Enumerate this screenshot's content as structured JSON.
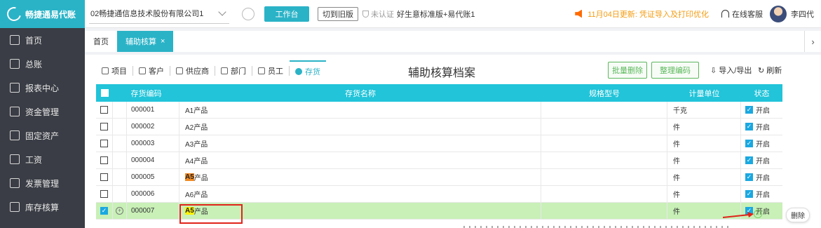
{
  "app": {
    "name": "畅捷通易代账"
  },
  "sidebar": {
    "items": [
      {
        "label": "首页",
        "icon": "home-icon"
      },
      {
        "label": "总账",
        "icon": "ledger-icon"
      },
      {
        "label": "报表中心",
        "icon": "chart-icon"
      },
      {
        "label": "资金管理",
        "icon": "money-icon"
      },
      {
        "label": "固定资产",
        "icon": "building-icon"
      },
      {
        "label": "工资",
        "icon": "wage-icon"
      },
      {
        "label": "发票管理",
        "icon": "invoice-icon"
      },
      {
        "label": "库存核算",
        "icon": "warehouse-icon"
      }
    ]
  },
  "topbar": {
    "company": "02畅捷通信息技术股份有限公司1",
    "workbench": "工作台",
    "old_version": "切到旧版",
    "auth_status": "未认证",
    "edition": "好生意标准版+易代账1",
    "notice": "11月04日更新: 凭证导入及打印优化",
    "service": "在线客服",
    "user": "李四代"
  },
  "tabs": {
    "home": "首页",
    "aux": "辅助核算",
    "close": "×"
  },
  "subnav": {
    "items": [
      {
        "label": "项目",
        "icon": "list-icon"
      },
      {
        "label": "客户",
        "icon": "user-icon"
      },
      {
        "label": "供应商",
        "icon": "supplier-icon"
      },
      {
        "label": "部门",
        "icon": "department-icon"
      },
      {
        "label": "员工",
        "icon": "employee-icon"
      },
      {
        "label": "存货",
        "icon": "inventory-icon",
        "active": true
      }
    ],
    "title": "辅助核算档案",
    "batch_delete": "批量删除",
    "organize_code": "整理编码",
    "import_export": "导入/导出",
    "refresh": "刷新"
  },
  "table": {
    "headers": {
      "code": "存货编码",
      "name": "存货名称",
      "spec": "规格型号",
      "unit": "计量单位",
      "status": "状态"
    },
    "rows": [
      {
        "code": "000001",
        "name_hl": "",
        "name": "A1产品",
        "spec": "",
        "unit": "千克",
        "status": "开启"
      },
      {
        "code": "000002",
        "name_hl": "",
        "name": "A2产品",
        "spec": "",
        "unit": "件",
        "status": "开启"
      },
      {
        "code": "000003",
        "name_hl": "",
        "name": "A3产品",
        "spec": "",
        "unit": "件",
        "status": "开启"
      },
      {
        "code": "000004",
        "name_hl": "",
        "name": "A4产品",
        "spec": "",
        "unit": "件",
        "status": "开启"
      },
      {
        "code": "000005",
        "name_hl": "A5",
        "name": "产品",
        "spec": "",
        "unit": "件",
        "status": "开启"
      },
      {
        "code": "000006",
        "name_hl": "",
        "name": "A6产品",
        "spec": "",
        "unit": "件",
        "status": "开启"
      },
      {
        "code": "000007",
        "name_hl": "A5",
        "name": "产品",
        "spec": "",
        "unit": "件",
        "status": "开启"
      }
    ],
    "delete_tooltip": "删除",
    "check_mark": "✓",
    "plus": "+",
    "x_mark": "×"
  },
  "colors": {
    "brand": "#2ab3c7",
    "header": "#21c4d9",
    "selected_row": "#c8f0b7",
    "highlight_orange": "#f08a24",
    "highlight_yellow": "#fff200",
    "annotation_red": "#e0241b"
  }
}
